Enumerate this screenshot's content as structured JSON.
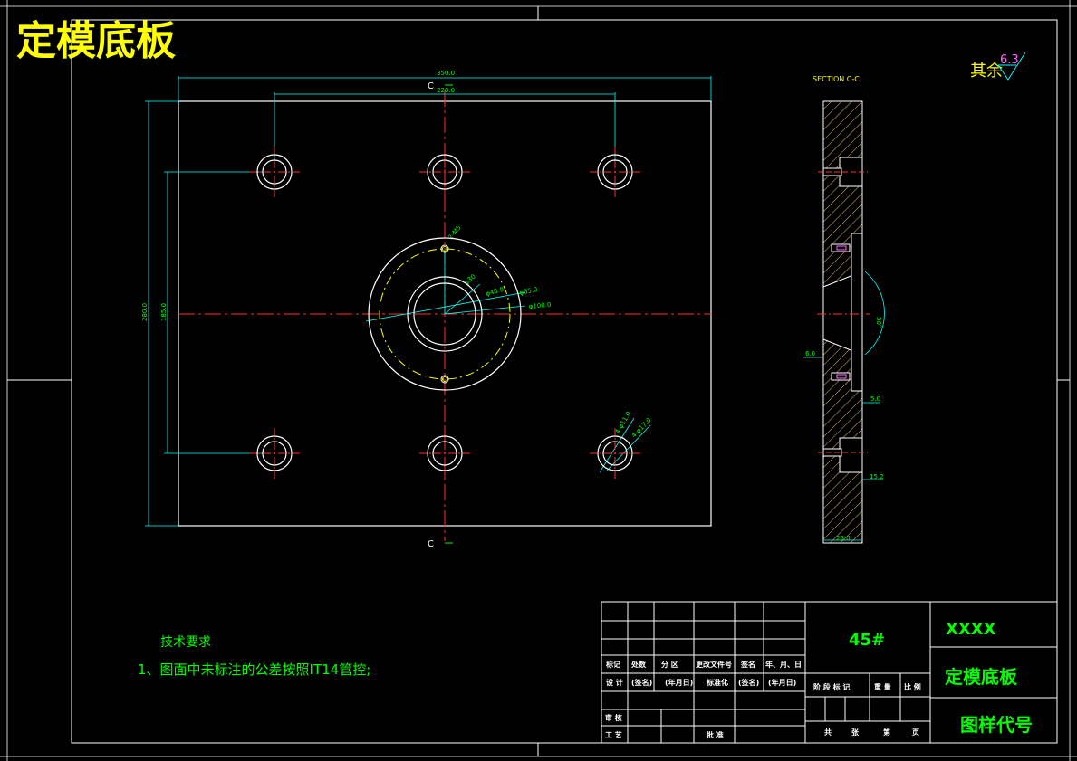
{
  "title": "定模底板",
  "roughness": {
    "label": "其余",
    "value": "6.3"
  },
  "section": {
    "title": "SECTION C-C",
    "marker": "C"
  },
  "dims": {
    "overall_width": "350.0",
    "hole_spacing_x": "220.0",
    "overall_height": "280.0",
    "hole_spacing_y": "185.0",
    "small_hole": "2-M5",
    "d_inner_a": "φ30",
    "d_inner_b": "φ40.0",
    "d_locating": "φ65.0",
    "d_flange": "φ100.0",
    "screw_hole_a": "4-φ11.0",
    "screw_hole_b": "4-φ17.0",
    "taper": "50°",
    "depth_a": "6.0",
    "depth_b": "5.0",
    "depth_c": "15.2",
    "thickness": "25.0"
  },
  "notes": {
    "heading": "技术要求",
    "item1": "1、图面中未标注的公差按照IT14管控;"
  },
  "title_block": {
    "material": "45#",
    "company": "XXXX",
    "part_name": "定模底板",
    "drawing_no": "图样代号",
    "row_mark": [
      "标记",
      "处数",
      "分 区",
      "更改文件号",
      "签名",
      "年、月、日"
    ],
    "row_design": [
      "设 计",
      "(签名)",
      "(年月日)",
      "标准化",
      "(签名)",
      "(年月日)"
    ],
    "stage_labels": [
      "阶 段 标 记",
      "重 量",
      "比 例"
    ],
    "sheet_labels": [
      "共",
      "张",
      "第",
      "页"
    ],
    "review": "审 核",
    "process": "工 艺",
    "approve": "批 准"
  }
}
